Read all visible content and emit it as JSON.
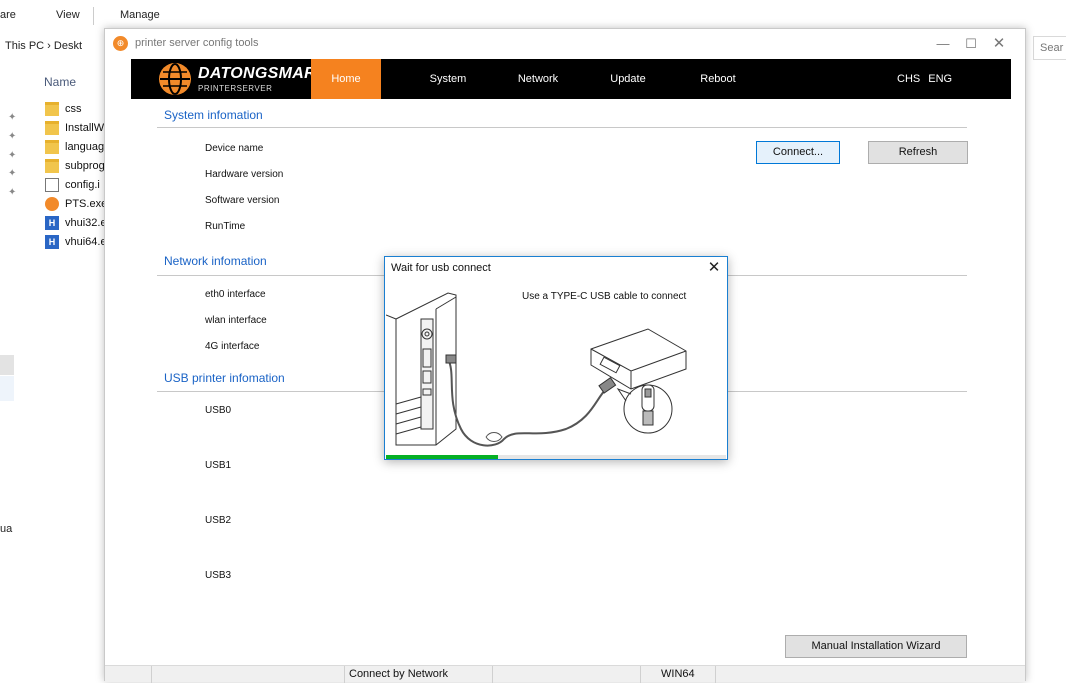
{
  "explorer": {
    "ribbon_tabs": [
      "are",
      "View",
      "Manage"
    ],
    "address": "This PC  ›  Deskt",
    "search_placeholder": "Sear",
    "column_name": "Name",
    "files": [
      {
        "name": "css",
        "icon": "folder-icon"
      },
      {
        "name": "InstallW",
        "icon": "folder-icon"
      },
      {
        "name": "languag",
        "icon": "folder-icon"
      },
      {
        "name": "subprog",
        "icon": "folder-icon"
      },
      {
        "name": "config.i",
        "icon": "config-file-icon"
      },
      {
        "name": "PTS.exe",
        "icon": "pts-app-icon"
      },
      {
        "name": "vhui32.e",
        "icon": "vhui-icon"
      },
      {
        "name": "vhui64.e",
        "icon": "vhui-icon"
      }
    ],
    "left_fragment": "ua"
  },
  "app": {
    "title": "printer server config tools",
    "brand": "DATONGSMART",
    "brand_sub": "PRINTERSERVER",
    "nav": [
      "Home",
      "System",
      "Network",
      "Update",
      "Reboot"
    ],
    "active_tab": "Home",
    "lang": [
      "CHS",
      "ENG"
    ],
    "sections": {
      "system": "System infomation",
      "network": "Network infomation",
      "usb": "USB printer infomation"
    },
    "system_fields": [
      "Device name",
      "Hardware version",
      "Software version",
      "RunTime"
    ],
    "network_fields": [
      "eth0 interface",
      "wlan interface",
      "4G interface"
    ],
    "usb_fields": [
      "USB0",
      "USB1",
      "USB2",
      "USB3"
    ],
    "buttons": {
      "connect": "Connect...",
      "refresh": "Refresh",
      "wizard": "Manual Installation Wizard"
    },
    "status": {
      "connect_mode": "Connect by Network",
      "platform": "WIN64"
    },
    "accent": "#f5821f",
    "link_color": "#1a63c6"
  },
  "dialog": {
    "title": "Wait for usb connect",
    "message": "Use a TYPE-C USB cable to connect",
    "progress": 0.33,
    "progress_color": "#06b025"
  }
}
